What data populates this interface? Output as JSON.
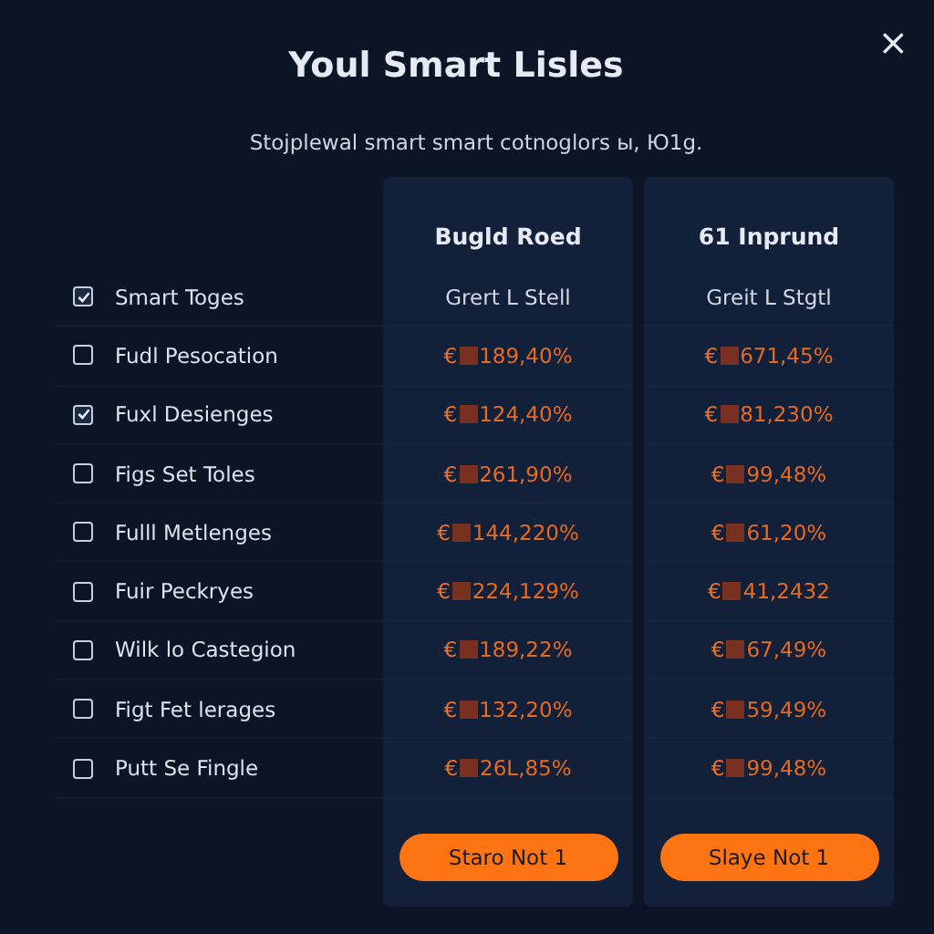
{
  "dialog": {
    "title": "Youl Smart Lisles",
    "subtitle": "Stojplewal smart smart cotnoglors ы, Ю1g.",
    "close": "×"
  },
  "rows": [
    {
      "label": "Smart Toges",
      "checked": true
    },
    {
      "label": "Fudl Pesocation",
      "checked": false
    },
    {
      "label": "Fuxl Desienges",
      "checked": true
    },
    {
      "label": "Figs Set Toles",
      "checked": false
    },
    {
      "label": "Fulll Metlenges",
      "checked": false
    },
    {
      "label": "Fuir Peckryes",
      "checked": false
    },
    {
      "label": "Wilk lo Castegion",
      "checked": false
    },
    {
      "label": "Figt Fet lerages",
      "checked": false
    },
    {
      "label": "Putt Se Fingle",
      "checked": false
    }
  ],
  "columns": [
    {
      "header": "Bugld Roed",
      "subheader": "Grert L Stell",
      "currency": "€",
      "values": [
        "189,40%",
        "124,40%",
        "261,90%",
        "144,220%",
        "224,129%",
        "189,22%",
        "132,20%",
        "26L,85%"
      ],
      "button": "Staro Not 1"
    },
    {
      "header": "61 Inprund",
      "subheader": "Greit L Stgtl",
      "currency": "€",
      "values": [
        "671,45%",
        "81,230%",
        "99,48%",
        "61,20%",
        "41,2432",
        "67,49%",
        "59,49%",
        "99,48%"
      ],
      "button": "Slaye Not 1"
    }
  ]
}
